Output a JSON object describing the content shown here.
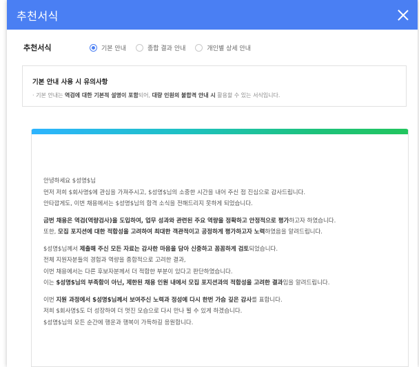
{
  "modal": {
    "title": "추천서식"
  },
  "template_row": {
    "label": "추천서식",
    "options": [
      {
        "label": "기본 안내",
        "checked": true
      },
      {
        "label": "종합 결과 안내",
        "checked": false
      },
      {
        "label": "개인별 상세 안내",
        "checked": false
      }
    ]
  },
  "notice": {
    "title": "기본 안내 사용 시 유의사항",
    "text_prefix": "· 기본 안내는 ",
    "text_bold1": "역검에 대한 기본적 설명이 포함",
    "text_mid": "되어, ",
    "text_bold2": "대량 인원의 불합격 안내 시",
    "text_suffix": " 활용할 수 있는 서식입니다."
  },
  "letter": {
    "greeting": "안녕하세요 $성명$님",
    "line1": "먼저 저희 $회사명$에 관심을 가져주시고, $성명$님의 소중한 시간을 내어 주신 점 진심으로 감사드립니다.",
    "line2": "안타깝게도, 이번 채용에서는 $성명$님의 합격 소식을 전해드리지 못하게 되었습니다.",
    "p2_line1": "금번 채용은 역검(역량검사)을 도입하여, 업무 성과와 관련된 주요 역량을 정확하고 안정적으로 평가",
    "p2_line1_suffix": "하고자 하였습니다.",
    "p2_line2_prefix": "또한, ",
    "p2_line2_bold": "모집 포지션에 대한 적합성을 고려하여 최대한 객관적이고 공정하게 평가하고자 노력",
    "p2_line2_suffix": "하였음을 알려드립니다.",
    "p3_line1_prefix": "$성명$님께서 ",
    "p3_line1_bold": "제출해 주신 모든 자료는 감사한 마음을 담아 신중하고 꼼꼼하게 검토",
    "p3_line1_suffix": "되었습니다.",
    "p3_line2": "전체 지원자분들의 경험과 역량을 종합적으로 고려한 결과,",
    "p3_line3": "이번 채용에서는 다른 후보자분께서 더 적합한 부분이 있다고 판단하였습니다.",
    "p3_line4_prefix": "이는 ",
    "p3_line4_bold": "$성명$님의 부족함이 아닌, 제한된 채용 인원 내에서 모집 포지션과의 적합성을 고려한 결과",
    "p3_line4_suffix": "임을 알려드립니다.",
    "p4_line1_prefix": "이번 ",
    "p4_line1_bold": "지원 과정에서 $성명$님께서 보여주신 노력과 정성에 다시 한번 가슴 깊은 감사",
    "p4_line1_suffix": "를 표합니다.",
    "p4_line2": "저희 $회사명$도 더 성장하여 더 멋진 모습으로 다시 만나 뵐 수 있게 하겠습니다.",
    "p4_line3": "$성명$님의 모든 순간에 행운과 행복이 가득하길 응원합니다."
  },
  "colors": {
    "header": "#4a7ff3",
    "accent": "#4a7ff3"
  }
}
